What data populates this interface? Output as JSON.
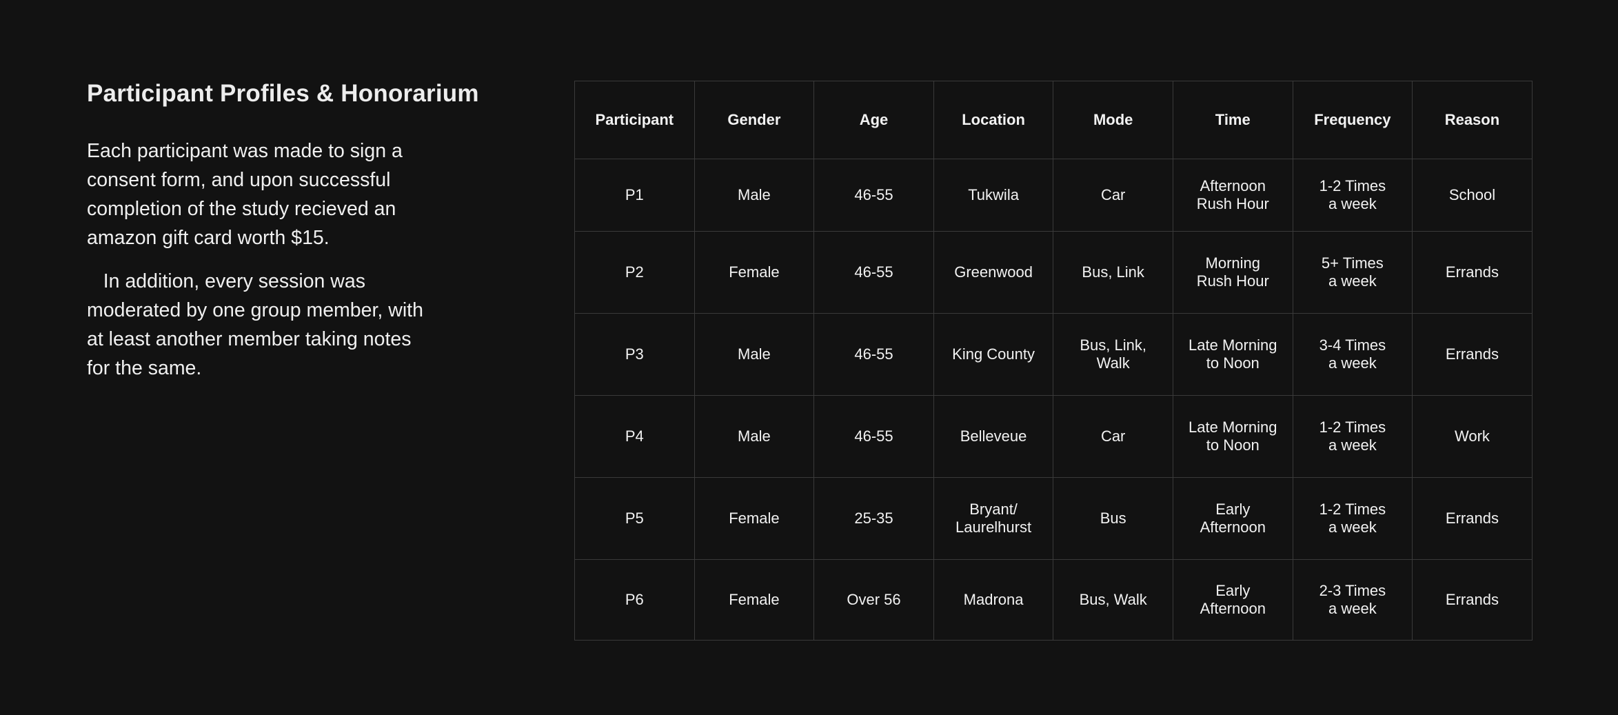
{
  "title": "Participant Profiles & Honorarium",
  "paragraphs": [
    "Each participant was made to sign a consent form, and upon successful completion of the study recieved an amazon gift card worth $15.",
    "   In addition, every session was moderated by one group member, with at least another member taking notes for the same."
  ],
  "table": {
    "headers": [
      "Participant",
      "Gender",
      "Age",
      "Location",
      "Mode",
      "Time",
      "Frequency",
      "Reason"
    ],
    "rows": [
      [
        "P1",
        "Male",
        "46-55",
        "Tukwila",
        "Car",
        "Afternoon\nRush Hour",
        "1-2 Times\na week",
        "School"
      ],
      [
        "P2",
        "Female",
        "46-55",
        "Greenwood",
        "Bus, Link",
        "Morning\nRush Hour",
        "5+ Times\na week",
        "Errands"
      ],
      [
        "P3",
        "Male",
        "46-55",
        "King County",
        "Bus, Link,\nWalk",
        "Late Morning\nto Noon",
        "3-4 Times\na week",
        "Errands"
      ],
      [
        "P4",
        "Male",
        "46-55",
        "Belleveue",
        "Car",
        "Late Morning\nto Noon",
        "1-2 Times\na week",
        "Work"
      ],
      [
        "P5",
        "Female",
        "25-35",
        "Bryant/\nLaurelhurst",
        "Bus",
        "Early\nAfternoon",
        "1-2 Times\na week",
        "Errands"
      ],
      [
        "P6",
        "Female",
        "Over 56",
        "Madrona",
        "Bus, Walk",
        "Early\nAfternoon",
        "2-3 Times\na week",
        "Errands"
      ]
    ]
  }
}
